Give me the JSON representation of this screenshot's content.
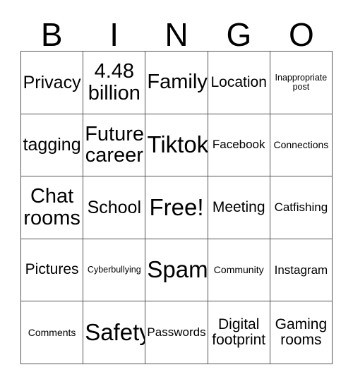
{
  "card": {
    "header_letters": [
      "B",
      "I",
      "N",
      "G",
      "O"
    ],
    "columns": 5,
    "rows": 5,
    "text_color": "#000000",
    "background_color": "#ffffff",
    "border_color": "#555555",
    "cells": [
      {
        "label": "Privacy",
        "size": "l",
        "free_space": false
      },
      {
        "label": "4.48\nbillion",
        "size": "xl",
        "free_space": false
      },
      {
        "label": "Family",
        "size": "xl",
        "free_space": false
      },
      {
        "label": "Location",
        "size": "m",
        "free_space": false
      },
      {
        "label": "Inappropriate\npost",
        "size": "xxs",
        "free_space": false
      },
      {
        "label": "tagging",
        "size": "l",
        "free_space": false
      },
      {
        "label": "Future\ncareer",
        "size": "xl",
        "free_space": false
      },
      {
        "label": "Tiktok",
        "size": "xxl",
        "free_space": false
      },
      {
        "label": "Facebook",
        "size": "s",
        "free_space": false
      },
      {
        "label": "Connections",
        "size": "xs",
        "free_space": false
      },
      {
        "label": "Chat\nrooms",
        "size": "xl",
        "free_space": false
      },
      {
        "label": "School",
        "size": "l",
        "free_space": false
      },
      {
        "label": "Free!",
        "size": "xxl",
        "free_space": true
      },
      {
        "label": "Meeting",
        "size": "m",
        "free_space": false
      },
      {
        "label": "Catfishing",
        "size": "s",
        "free_space": false
      },
      {
        "label": "Pictures",
        "size": "m",
        "free_space": false
      },
      {
        "label": "Cyberbullying",
        "size": "xxs",
        "free_space": false
      },
      {
        "label": "Spam",
        "size": "xxl",
        "free_space": false
      },
      {
        "label": "Community",
        "size": "xs",
        "free_space": false
      },
      {
        "label": "Instagram",
        "size": "s",
        "free_space": false
      },
      {
        "label": "Comments",
        "size": "xs",
        "free_space": false
      },
      {
        "label": "Safety",
        "size": "xxl",
        "free_space": false
      },
      {
        "label": "Passwords",
        "size": "s",
        "free_space": false
      },
      {
        "label": "Digital\nfootprint",
        "size": "m",
        "free_space": false
      },
      {
        "label": "Gaming\nrooms",
        "size": "m",
        "free_space": false
      }
    ]
  }
}
